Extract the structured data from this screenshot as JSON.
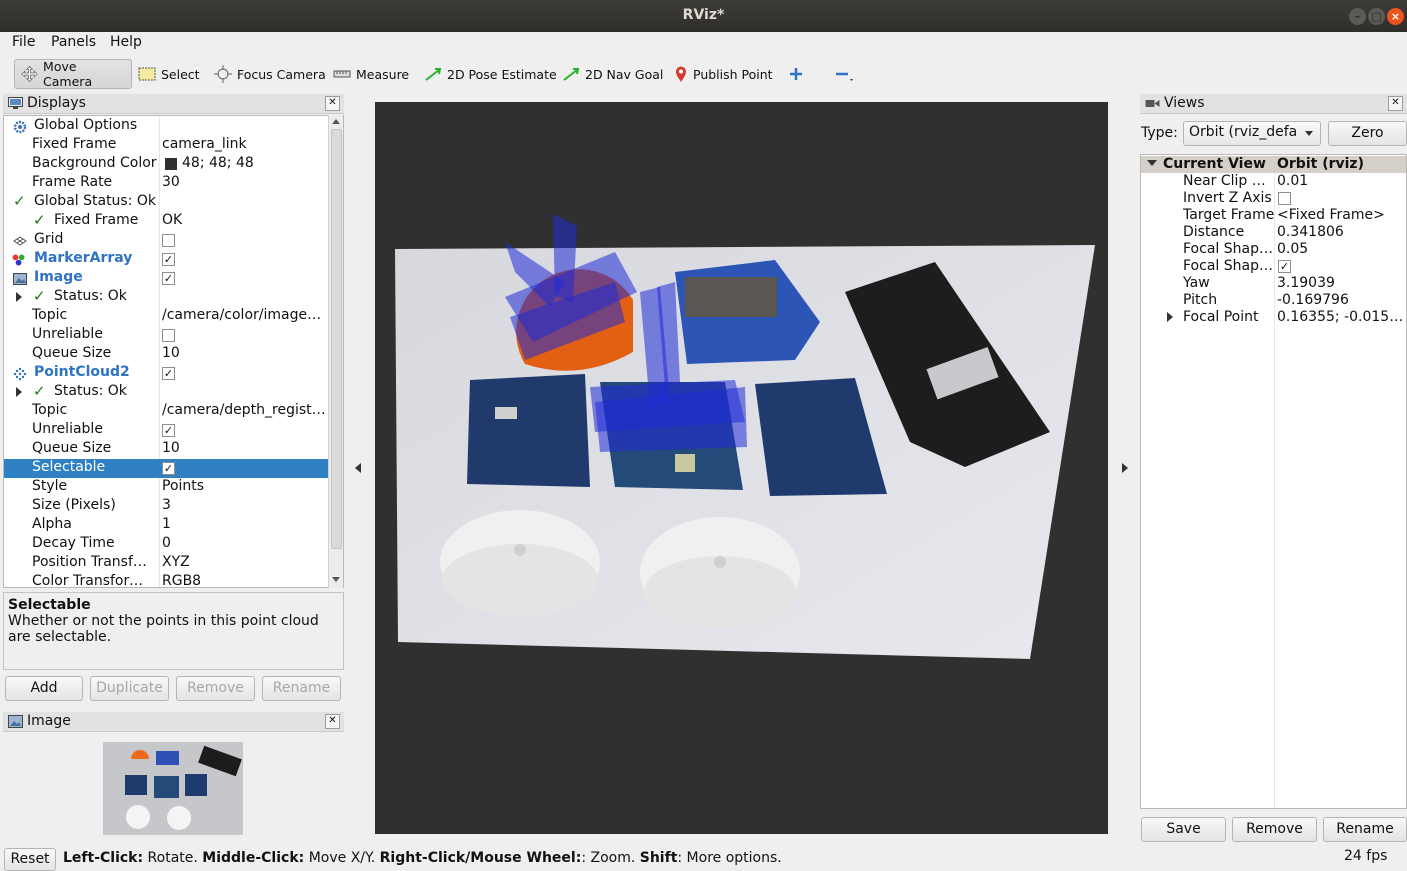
{
  "window": {
    "title": "RViz*"
  },
  "menu": {
    "file": "File",
    "panels": "Panels",
    "help": "Help"
  },
  "toolbar": {
    "move_camera": "Move Camera",
    "select": "Select",
    "focus_camera": "Focus Camera",
    "measure": "Measure",
    "pose_estimate": "2D Pose Estimate",
    "nav_goal": "2D Nav Goal",
    "publish_point": "Publish Point"
  },
  "displays": {
    "title": "Displays",
    "rows": [
      {
        "name": "Global Options",
        "value": ""
      },
      {
        "name": "Fixed Frame",
        "value": "camera_link"
      },
      {
        "name": "Background Color",
        "value": "48; 48; 48"
      },
      {
        "name": "Frame Rate",
        "value": "30"
      },
      {
        "name": "Global Status: Ok",
        "value": ""
      },
      {
        "name": "Fixed Frame",
        "value": "OK"
      },
      {
        "name": "Grid",
        "value": ""
      },
      {
        "name": "MarkerArray",
        "value": ""
      },
      {
        "name": "Image",
        "value": ""
      },
      {
        "name": "Status: Ok",
        "value": ""
      },
      {
        "name": "Topic",
        "value": "/camera/color/image_raw"
      },
      {
        "name": "Unreliable",
        "value": ""
      },
      {
        "name": "Queue Size",
        "value": "10"
      },
      {
        "name": "PointCloud2",
        "value": ""
      },
      {
        "name": "Status: Ok",
        "value": ""
      },
      {
        "name": "Topic",
        "value": "/camera/depth_registered/points"
      },
      {
        "name": "Unreliable",
        "value": ""
      },
      {
        "name": "Queue Size",
        "value": "10"
      },
      {
        "name": "Selectable",
        "value": ""
      },
      {
        "name": "Style",
        "value": "Points"
      },
      {
        "name": "Size (Pixels)",
        "value": "3"
      },
      {
        "name": "Alpha",
        "value": "1"
      },
      {
        "name": "Decay Time",
        "value": "0"
      },
      {
        "name": "Position Transformer",
        "value": "XYZ"
      },
      {
        "name": "Color Transformer",
        "value": "RGB8"
      }
    ],
    "background_color": "#303030",
    "description_title": "Selectable",
    "description_text": "Whether or not the points in this point cloud are selectable.",
    "buttons": {
      "add": "Add",
      "duplicate": "Duplicate",
      "remove": "Remove",
      "rename": "Rename"
    }
  },
  "image_panel": {
    "title": "Image"
  },
  "views": {
    "title": "Views",
    "type_label": "Type:",
    "type_value": "Orbit (rviz_default_plugins)",
    "zero": "Zero",
    "header_name": "Current View",
    "header_value": "Orbit (rviz)",
    "rows": [
      {
        "name": "Near Clip Distance",
        "value": "0.01"
      },
      {
        "name": "Invert Z Axis",
        "value": ""
      },
      {
        "name": "Target Frame",
        "value": "<Fixed Frame>"
      },
      {
        "name": "Distance",
        "value": "0.341806"
      },
      {
        "name": "Focal Shape Size",
        "value": "0.05"
      },
      {
        "name": "Focal Shape Fixed Size",
        "value": ""
      },
      {
        "name": "Yaw",
        "value": "3.19039"
      },
      {
        "name": "Pitch",
        "value": "-0.169796"
      },
      {
        "name": "Focal Point",
        "value": "0.16355; -0.0151..."
      }
    ],
    "buttons": {
      "save": "Save",
      "remove": "Remove",
      "rename": "Rename"
    }
  },
  "statusbar": {
    "reset": "Reset",
    "left_click_key": "Left-Click:",
    "left_click_action": " Rotate. ",
    "middle_click_key": "Middle-Click:",
    "middle_click_action": " Move X/Y. ",
    "right_click_key": "Right-Click/Mouse Wheel:",
    "right_click_action": ": Zoom. ",
    "shift_key": "Shift",
    "shift_action": ": More options.",
    "fps": "24 fps"
  }
}
